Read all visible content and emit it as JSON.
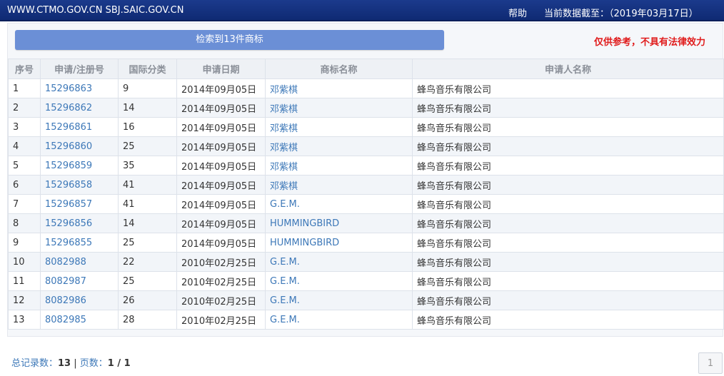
{
  "header": {
    "site_label": "WWW.CTMO.GOV.CN SBJ.SAIC.GOV.CN",
    "help_label": "帮助",
    "data_cutoff": "当前数据截至：（2019年03月17日）"
  },
  "search": {
    "result_label": "检索到13件商标",
    "disclaimer": "仅供参考，不具有法律效力"
  },
  "table": {
    "columns": [
      "序号",
      "申请/注册号",
      "国际分类",
      "申请日期",
      "商标名称",
      "申请人名称"
    ],
    "rows": [
      {
        "no": "1",
        "reg_no": "15296863",
        "class": "9",
        "date": "2014年09月05日",
        "mark": "邓紫棋",
        "applicant": "蜂鸟音乐有限公司"
      },
      {
        "no": "2",
        "reg_no": "15296862",
        "class": "14",
        "date": "2014年09月05日",
        "mark": "邓紫棋",
        "applicant": "蜂鸟音乐有限公司"
      },
      {
        "no": "3",
        "reg_no": "15296861",
        "class": "16",
        "date": "2014年09月05日",
        "mark": "邓紫棋",
        "applicant": "蜂鸟音乐有限公司"
      },
      {
        "no": "4",
        "reg_no": "15296860",
        "class": "25",
        "date": "2014年09月05日",
        "mark": "邓紫棋",
        "applicant": "蜂鸟音乐有限公司"
      },
      {
        "no": "5",
        "reg_no": "15296859",
        "class": "35",
        "date": "2014年09月05日",
        "mark": "邓紫棋",
        "applicant": "蜂鸟音乐有限公司"
      },
      {
        "no": "6",
        "reg_no": "15296858",
        "class": "41",
        "date": "2014年09月05日",
        "mark": "邓紫棋",
        "applicant": "蜂鸟音乐有限公司"
      },
      {
        "no": "7",
        "reg_no": "15296857",
        "class": "41",
        "date": "2014年09月05日",
        "mark": "G.E.M.",
        "applicant": "蜂鸟音乐有限公司"
      },
      {
        "no": "8",
        "reg_no": "15296856",
        "class": "14",
        "date": "2014年09月05日",
        "mark": "HUMMINGBIRD",
        "applicant": "蜂鸟音乐有限公司"
      },
      {
        "no": "9",
        "reg_no": "15296855",
        "class": "25",
        "date": "2014年09月05日",
        "mark": "HUMMINGBIRD",
        "applicant": "蜂鸟音乐有限公司"
      },
      {
        "no": "10",
        "reg_no": "8082988",
        "class": "22",
        "date": "2010年02月25日",
        "mark": "G.E.M.",
        "applicant": "蜂鸟音乐有限公司"
      },
      {
        "no": "11",
        "reg_no": "8082987",
        "class": "25",
        "date": "2010年02月25日",
        "mark": "G.E.M.",
        "applicant": "蜂鸟音乐有限公司"
      },
      {
        "no": "12",
        "reg_no": "8082986",
        "class": "26",
        "date": "2010年02月25日",
        "mark": "G.E.M.",
        "applicant": "蜂鸟音乐有限公司"
      },
      {
        "no": "13",
        "reg_no": "8082985",
        "class": "28",
        "date": "2010年02月25日",
        "mark": "G.E.M.",
        "applicant": "蜂鸟音乐有限公司"
      }
    ]
  },
  "footer": {
    "total_label": "总记录数：",
    "total_value": "13",
    "separator": "|",
    "pages_label": "页数：",
    "pages_value": "1 / 1",
    "page_button": "1"
  },
  "colors": {
    "header_bg": "#0f2a73",
    "accent_button": "#6b8fd6",
    "link": "#3d78b8",
    "disclaimer": "#e01b1b"
  }
}
